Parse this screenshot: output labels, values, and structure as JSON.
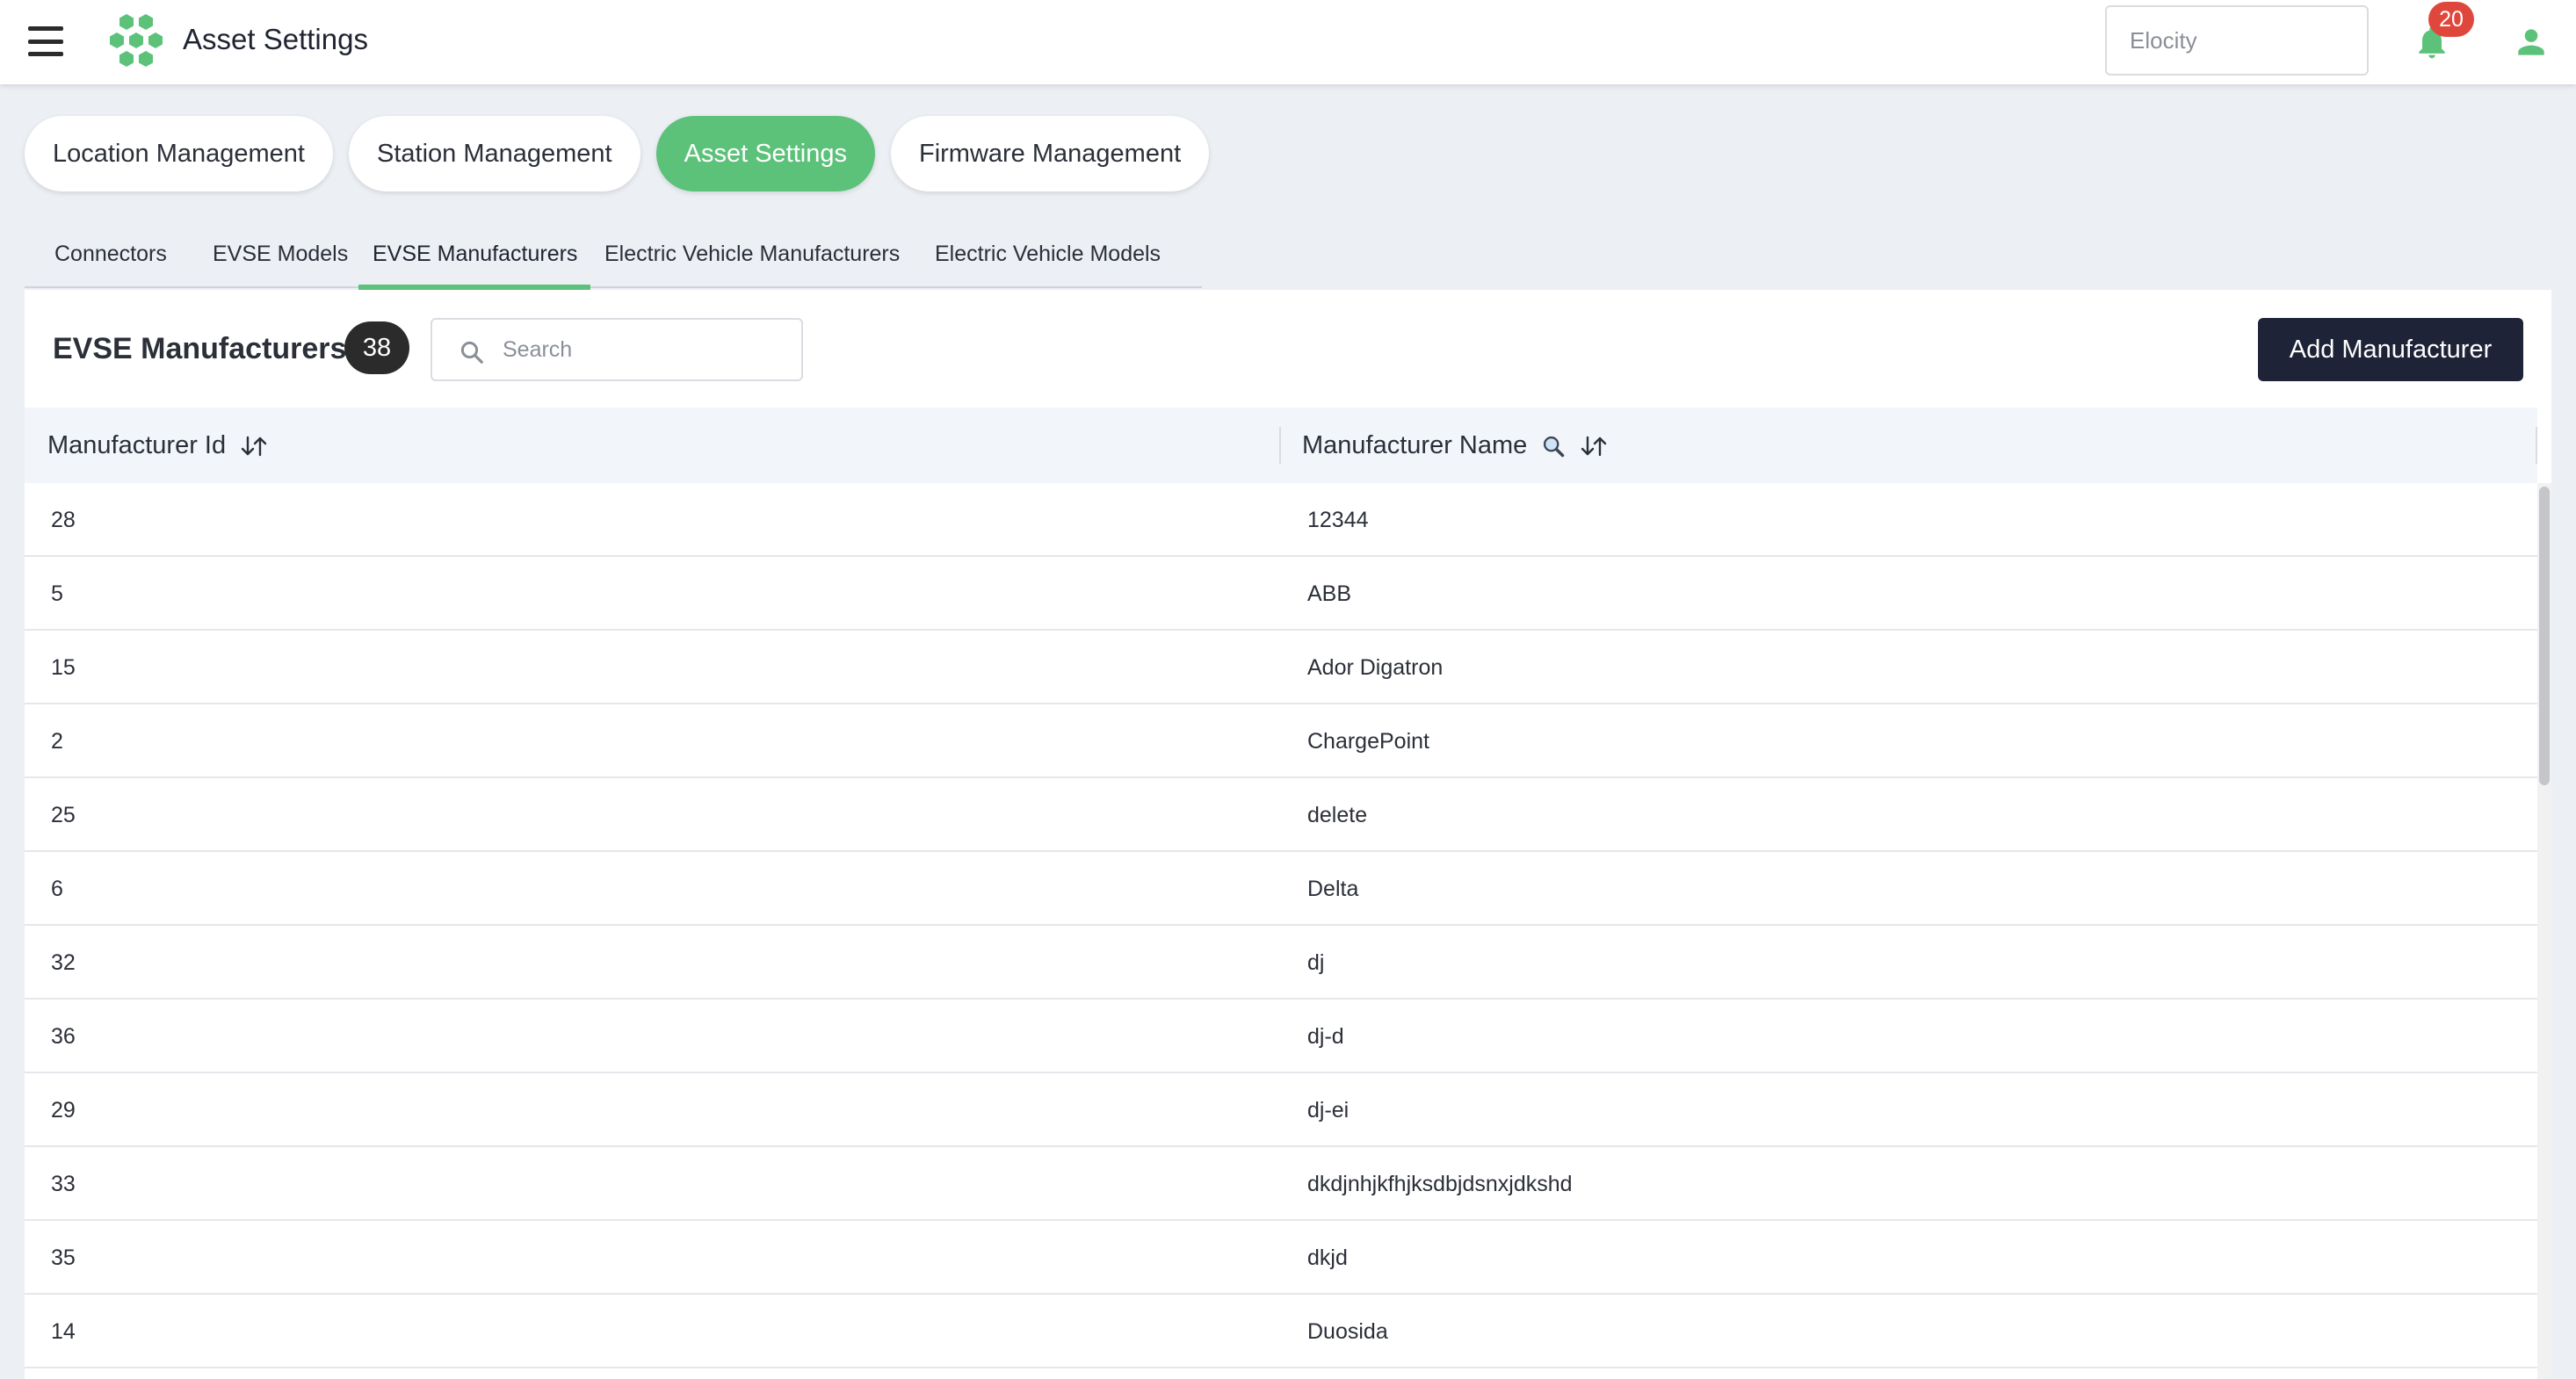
{
  "header": {
    "title": "Asset Settings",
    "org_value": "Elocity",
    "notification_count": "20"
  },
  "colors": {
    "accent": "#5cc27a",
    "primary_button": "#1e2337",
    "badge": "#e0473c"
  },
  "main_tabs": [
    {
      "label": "Location Management",
      "active": false
    },
    {
      "label": "Station Management",
      "active": false
    },
    {
      "label": "Asset Settings",
      "active": true
    },
    {
      "label": "Firmware Management",
      "active": false
    }
  ],
  "sub_tabs": [
    {
      "label": "Connectors",
      "active": false
    },
    {
      "label": "EVSE Models",
      "active": false
    },
    {
      "label": "EVSE Manufacturers",
      "active": true
    },
    {
      "label": "Electric Vehicle Manufacturers",
      "active": false
    },
    {
      "label": "Electric Vehicle Models",
      "active": false
    }
  ],
  "card": {
    "title": "EVSE Manufacturers",
    "count": "38",
    "search_placeholder": "Search",
    "add_button": "Add Manufacturer"
  },
  "table": {
    "columns": [
      "Manufacturer Id",
      "Manufacturer Name"
    ],
    "rows": [
      {
        "id": "28",
        "name": "12344"
      },
      {
        "id": "5",
        "name": "ABB"
      },
      {
        "id": "15",
        "name": "Ador Digatron"
      },
      {
        "id": "2",
        "name": "ChargePoint"
      },
      {
        "id": "25",
        "name": "delete"
      },
      {
        "id": "6",
        "name": "Delta"
      },
      {
        "id": "32",
        "name": "dj"
      },
      {
        "id": "36",
        "name": "dj-d"
      },
      {
        "id": "29",
        "name": "dj-ei"
      },
      {
        "id": "33",
        "name": "dkdjnhjkfhjksdbjdsnxjdkshd"
      },
      {
        "id": "35",
        "name": "dkjd"
      },
      {
        "id": "14",
        "name": "Duosida"
      }
    ]
  }
}
